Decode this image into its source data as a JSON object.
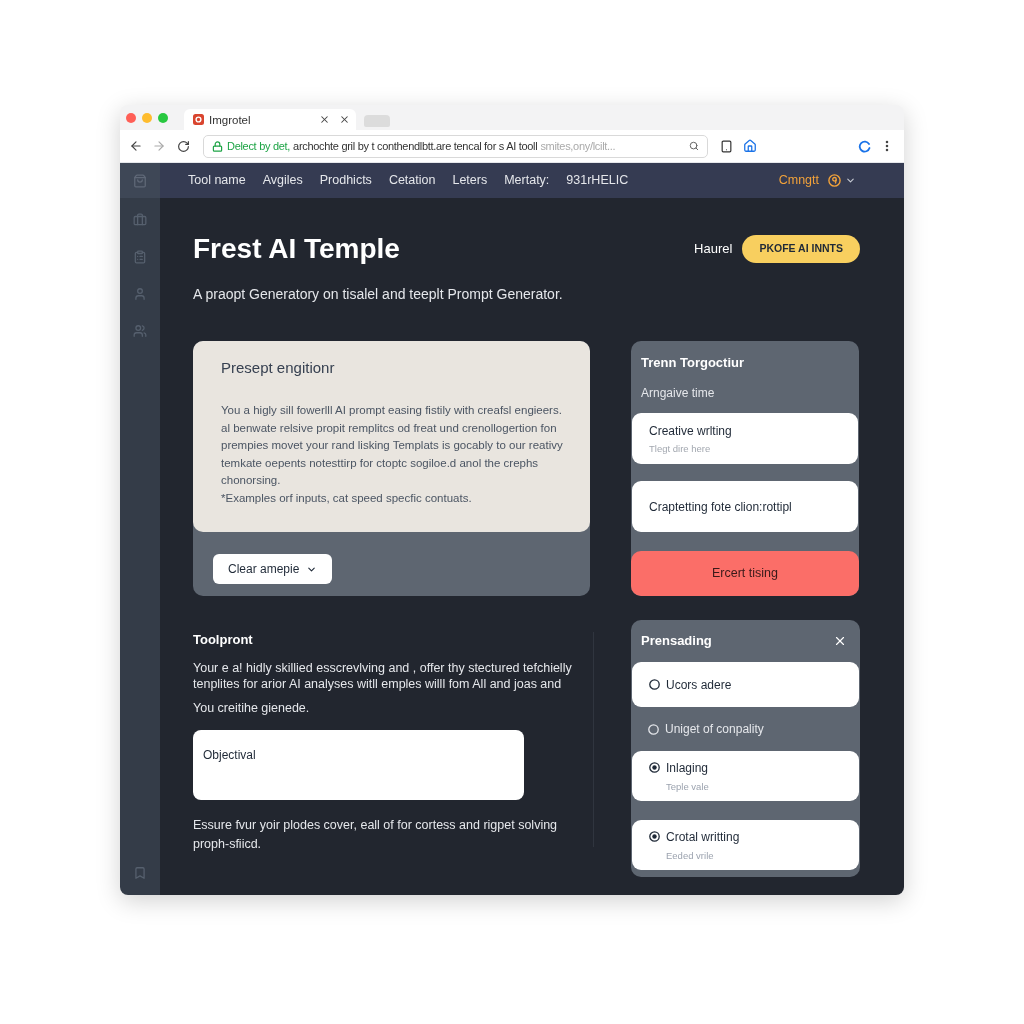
{
  "browser": {
    "tab": {
      "title": "Imgrotel"
    },
    "address": {
      "secure_label": "Delect by det,",
      "text": "archochte gril by t conthendlbtt.are tencal for s AI tooll",
      "faded": "smites,ony/lcilt..."
    }
  },
  "nav": {
    "items": [
      {
        "label": "Tool name"
      },
      {
        "label": "Avgiles"
      },
      {
        "label": "Prodhicts"
      },
      {
        "label": "Cetation"
      },
      {
        "label": "Leters"
      },
      {
        "label": "Mertaty:"
      },
      {
        "label": "931rHELIC"
      }
    ],
    "account": {
      "label": "Cmngtt"
    }
  },
  "header": {
    "title": "Frest AI Temple",
    "link": "Haurel",
    "button": "PKOFE AI INNTS",
    "subtitle": "A praopt Generatory on tisalel and teeplt Prompt Generator."
  },
  "prompt_card": {
    "title": "Presept engitionr",
    "body": "You a higly sill fowerlll AI prompt easing fistily with creafsl engieers. al benwate relsive propit remplitcs od freat und crenollogertion fon prempies movet your rand lisking Templats is gocably to our reativy temkate oepents notesttirp for ctoptc sogiloe.d anol the crephs chonorsing.",
    "note": "*Examples orf inputs, cat speed specfic contuats.",
    "button": "Clear amepie"
  },
  "template_panel": {
    "title": "Trenn Torgoctiur",
    "subtitle": "Arngaive time",
    "options": [
      {
        "title": "Creative wrlting",
        "hint": "Tlegt dire here"
      },
      {
        "title": "Craptetting fote clion:rottipl"
      }
    ],
    "button": "Ercert tising"
  },
  "tool_prompt": {
    "title": "Toolpront",
    "body": "Your e a! hidly skillied esscrevlving and , offer thy stectured tefchielly tenplites for arior AI analyses witll emples willl fom All and joas and",
    "note": "You creitihe gienede.",
    "input": {
      "value": "Objectival"
    },
    "footer": "Essure fvur yoir plodes cover, eall of for cortess and rigpet solving proph-sfiicd."
  },
  "presets_panel": {
    "title": "Prensading",
    "options": [
      {
        "label": "Ucors adere",
        "kind": "card",
        "selected": false
      },
      {
        "label": "Uniget of conpality",
        "kind": "plain",
        "selected": false
      },
      {
        "label": "Inlaging",
        "hint": "Teple vale",
        "kind": "card",
        "selected": true
      },
      {
        "label": "Crotal writting",
        "hint": "Eeded vrile",
        "kind": "card",
        "selected": true
      }
    ]
  }
}
